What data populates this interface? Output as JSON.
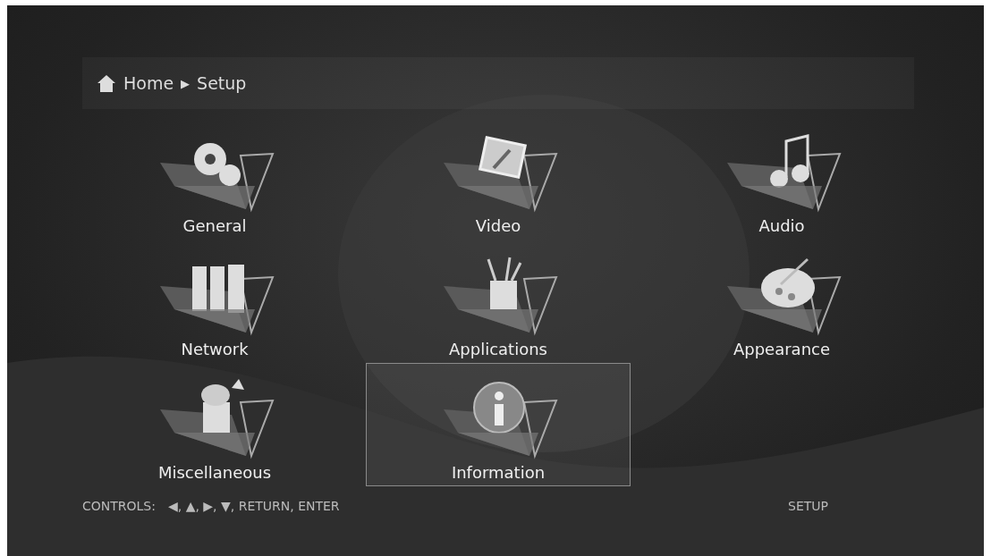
{
  "breadcrumb": {
    "items": [
      "Home",
      "Setup"
    ],
    "separator": "▶"
  },
  "menu": [
    {
      "label": "General",
      "kind": "gears",
      "selected": false
    },
    {
      "label": "Video",
      "kind": "video",
      "selected": false
    },
    {
      "label": "Audio",
      "kind": "audio",
      "selected": false
    },
    {
      "label": "Network",
      "kind": "network",
      "selected": false
    },
    {
      "label": "Applications",
      "kind": "tools",
      "selected": false
    },
    {
      "label": "Appearance",
      "kind": "palette",
      "selected": false
    },
    {
      "label": "Miscellaneous",
      "kind": "misc",
      "selected": false
    },
    {
      "label": "Information",
      "kind": "info",
      "selected": true
    }
  ],
  "status_bar": {
    "label": "CONTROLS:",
    "keys": "◀, ▲, ▶, ▼, RETURN, ENTER",
    "section": "SETUP"
  }
}
